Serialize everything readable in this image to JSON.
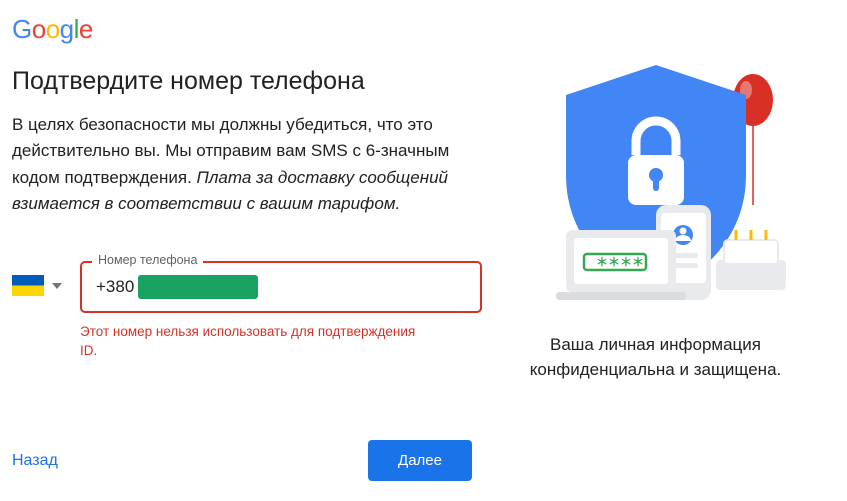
{
  "logo_letters": [
    "G",
    "o",
    "o",
    "g",
    "l",
    "e"
  ],
  "heading": "Подтвердите номер телефона",
  "body_plain": "В целях безопасности мы должны убедиться, что это действительно вы. Мы отправим вам SMS с 6-значным кодом подтверждения. ",
  "body_italic": "Плата за доставку сообщений взимается в соответствии с вашим тарифом.",
  "phone": {
    "label": "Номер телефона",
    "value": "+380",
    "country": "Ukraine",
    "error": "Этот номер нельзя использовать для подтверждения ID."
  },
  "actions": {
    "back": "Назад",
    "next": "Далее"
  },
  "caption": "Ваша личная информация конфиденциальна и защищена."
}
